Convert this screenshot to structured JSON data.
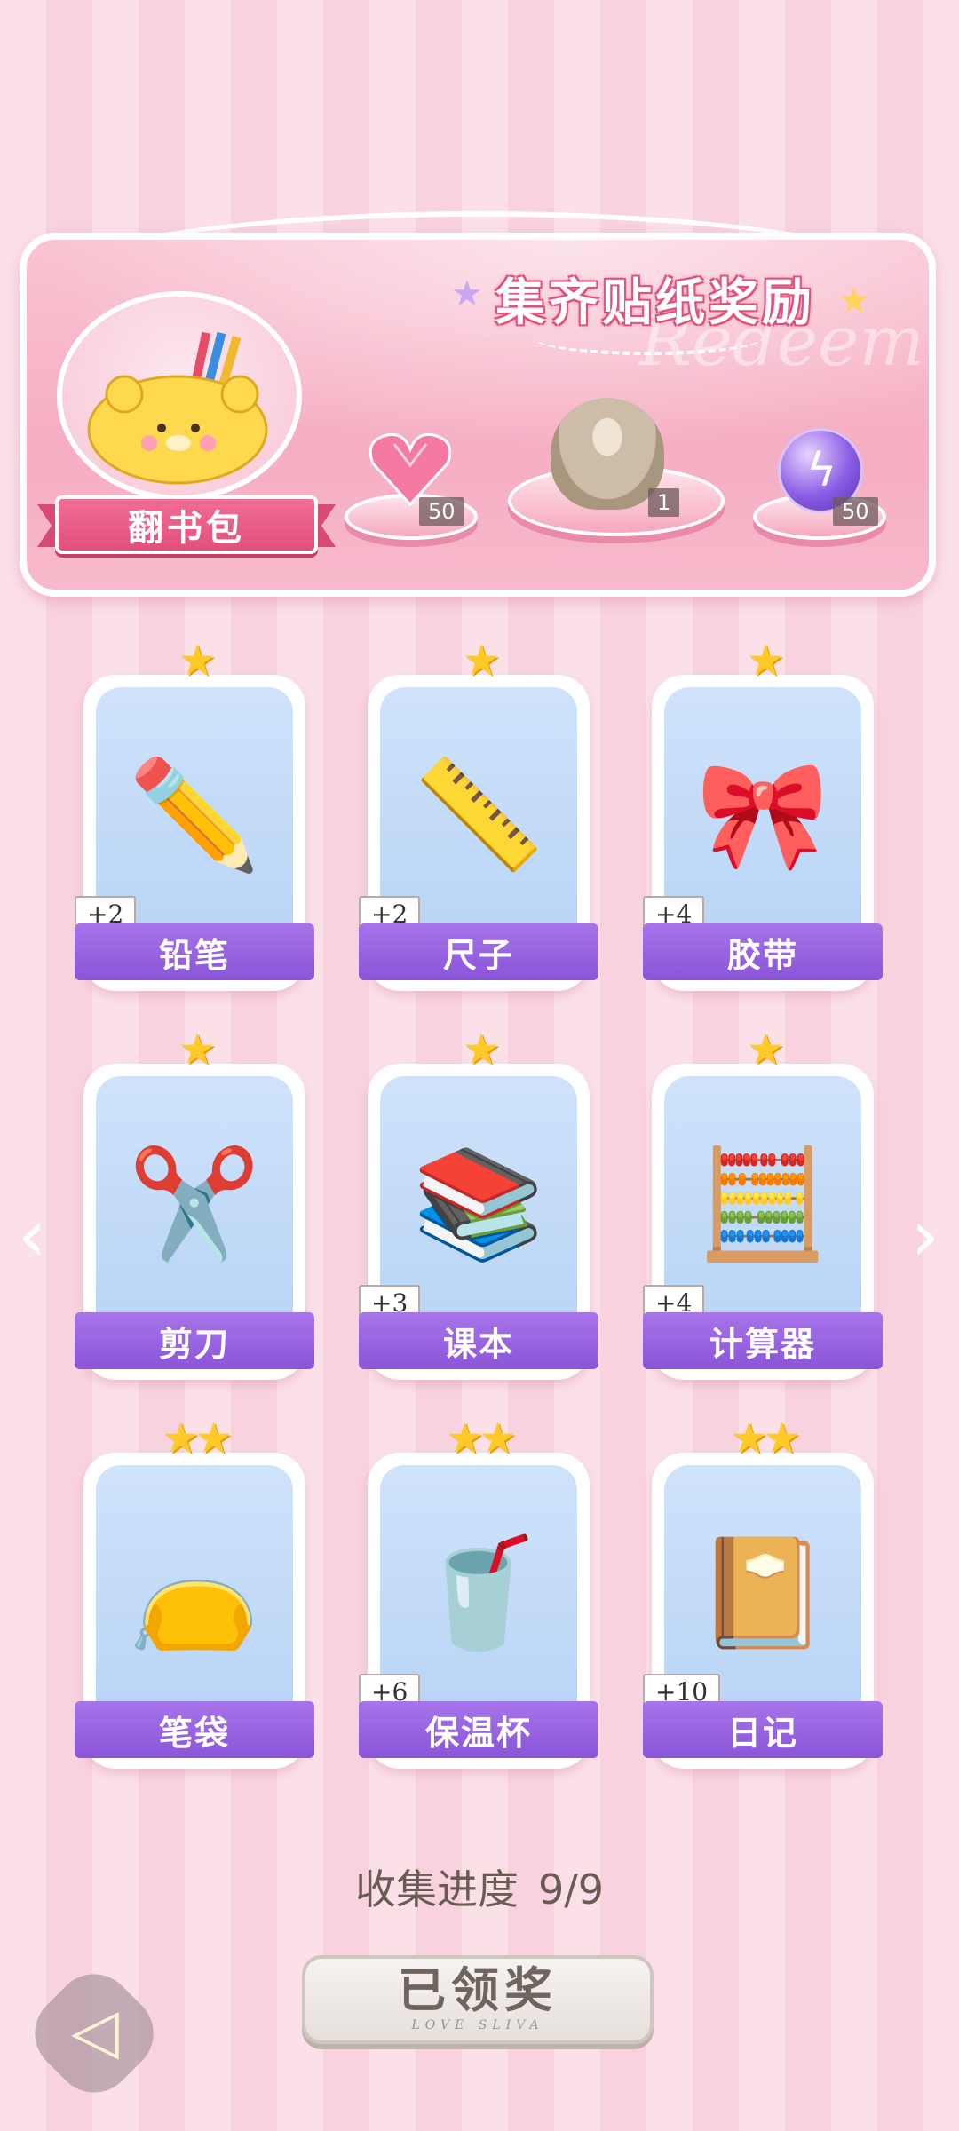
{
  "banner": {
    "title": "集齐贴纸奖励",
    "watermark": "Redeem",
    "collection_name": "翻书包",
    "rewards": [
      {
        "icon": "pink-heart-gem-icon",
        "count": "50"
      },
      {
        "icon": "character-avatar-icon",
        "count": "1"
      },
      {
        "icon": "purple-energy-orb-icon",
        "count": "50"
      }
    ]
  },
  "stickers": [
    {
      "name": "铅笔",
      "bonus": "+2",
      "stars": "★",
      "icon": "pencil-icon"
    },
    {
      "name": "尺子",
      "bonus": "+2",
      "stars": "★",
      "icon": "ruler-icon"
    },
    {
      "name": "胶带",
      "bonus": "+4",
      "stars": "★",
      "icon": "tape-icon"
    },
    {
      "name": "剪刀",
      "bonus": "",
      "stars": "★",
      "icon": "scissors-icon"
    },
    {
      "name": "课本",
      "bonus": "+3",
      "stars": "★",
      "icon": "textbook-icon"
    },
    {
      "name": "计算器",
      "bonus": "+4",
      "stars": "★",
      "icon": "calculator-icon"
    },
    {
      "name": "笔袋",
      "bonus": "",
      "stars": "★★",
      "icon": "pencil-case-icon"
    },
    {
      "name": "保温杯",
      "bonus": "+6",
      "stars": "★★",
      "icon": "thermos-icon"
    },
    {
      "name": "日记",
      "bonus": "+10",
      "stars": "★★",
      "icon": "diary-icon"
    }
  ],
  "progress": {
    "label": "收集进度",
    "value": "9/9"
  },
  "claim_button": {
    "label": "已领奖",
    "sub": "LOVE SLIVA"
  },
  "colors": {
    "accent_pink": "#e0507c",
    "label_purple": "#8a55d8",
    "star_gold": "#ffc928"
  }
}
